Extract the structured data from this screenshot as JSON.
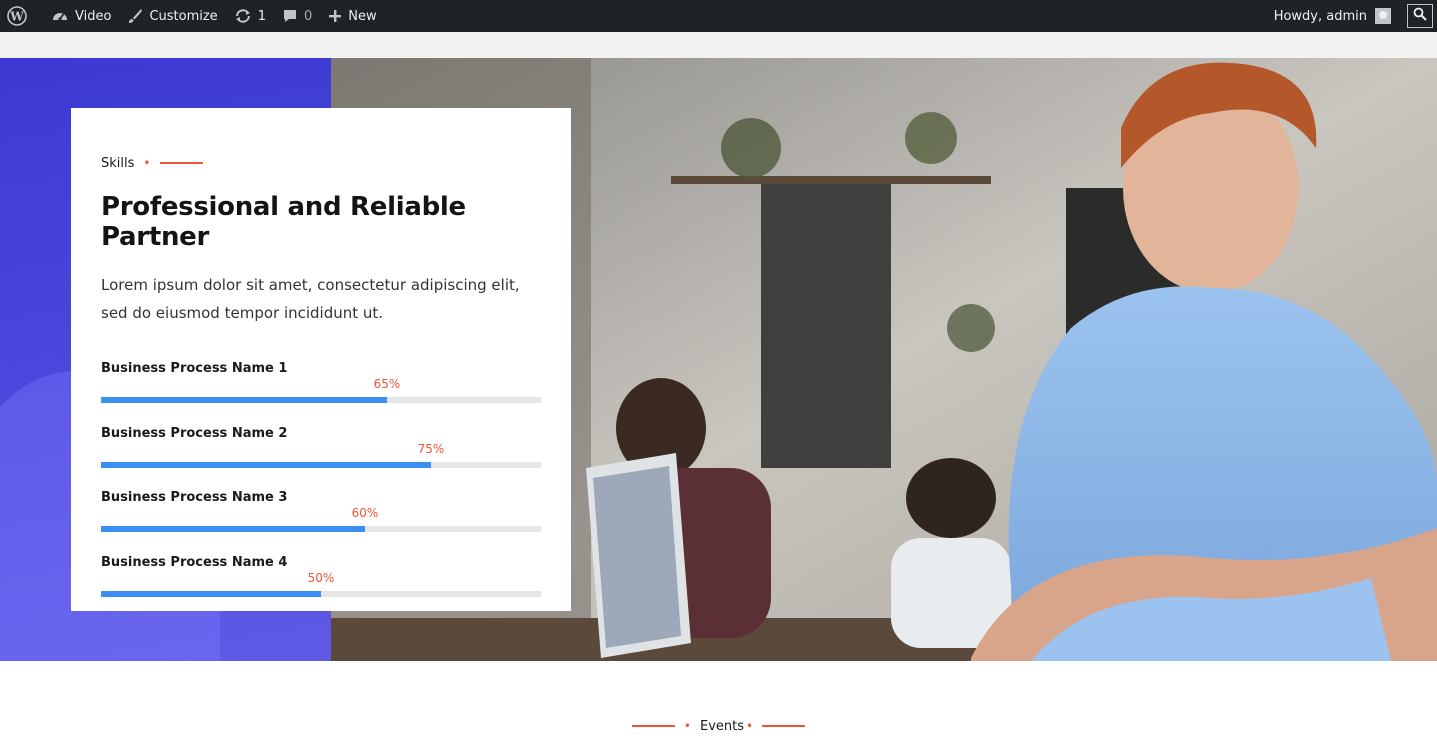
{
  "adminbar": {
    "wp_icon": "wordpress-logo-icon",
    "items": [
      {
        "icon": "dashboard-gauge-icon",
        "label": "Video"
      },
      {
        "icon": "brush-icon",
        "label": "Customize"
      },
      {
        "icon": "updates-icon",
        "label": "1"
      },
      {
        "icon": "comment-icon",
        "label": "0"
      },
      {
        "icon": "plus-icon",
        "label": "New"
      }
    ],
    "howdy": "Howdy, admin",
    "search_icon": "search-icon"
  },
  "skills": {
    "kicker": "Skills",
    "title": "Professional and Reliable Partner",
    "text": "Lorem ipsum dolor sit amet, consectetur adipiscing elit, sed do eiusmod tempor incididunt ut.",
    "items": [
      {
        "name": "Business Process Name 1",
        "percent_label": "65%",
        "value": 65
      },
      {
        "name": "Business Process Name 2",
        "percent_label": "75%",
        "value": 75
      },
      {
        "name": "Business Process Name 3",
        "percent_label": "60%",
        "value": 60
      },
      {
        "name": "Business Process Name 4",
        "percent_label": "50%",
        "value": 50
      }
    ]
  },
  "events": {
    "label": "Events"
  },
  "colors": {
    "adminbar_bg": "#1d2327",
    "accent_red": "#f0543c",
    "progress_blue": "#3b8ff3",
    "hero_purple": "#4a46dc"
  }
}
